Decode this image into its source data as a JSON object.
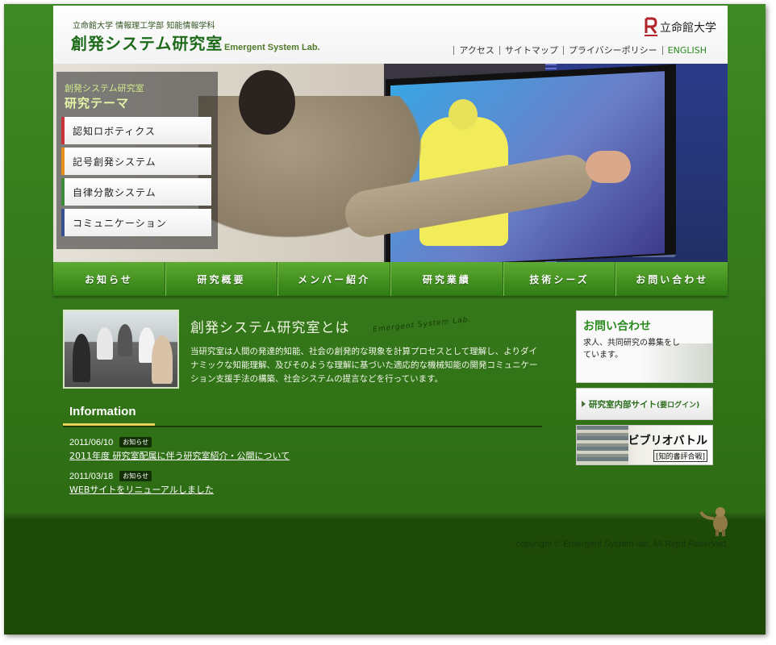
{
  "header": {
    "department": "立命館大学 情報理工学部 知能情報学科",
    "lab_name": "創発システム研究室",
    "lab_name_en": "Emergent System Lab.",
    "university": "立命館大学",
    "util_nav": [
      "アクセス",
      "サイトマップ",
      "プライバシーポリシー",
      "ENGLISH"
    ]
  },
  "research": {
    "subtitle": "創発システム研究室",
    "title": "研究テーマ",
    "items": [
      {
        "label": "認知ロボティクス",
        "color": "#c8333a"
      },
      {
        "label": "記号創発システム",
        "color": "#e8901c"
      },
      {
        "label": "自律分散システム",
        "color": "#3d8a3a"
      },
      {
        "label": "コミュニケーション",
        "color": "#35508a"
      }
    ]
  },
  "global_nav": [
    "お知らせ",
    "研究概要",
    "メンバー紹介",
    "研究業績",
    "技術シーズ",
    "お問い合わせ"
  ],
  "about": {
    "title": "創発システム研究室とは",
    "title_en": "Emergent System Lab.",
    "text": "当研究室は人間の発達的知能、社会の創発的な現象を計算プロセスとして理解し、よりダイナミックな知能理解、及びそのような理解に基づいた適応的な機械知能の開発コミュニケーション支援手法の構築、社会システムの提言などを行っています。"
  },
  "information": {
    "heading": "Information",
    "items": [
      {
        "date": "2011/06/10",
        "badge": "お知らせ",
        "title": "2011年度 研究室配属に伴う研究室紹介・公開について"
      },
      {
        "date": "2011/03/18",
        "badge": "お知らせ",
        "title": "WEBサイトをリニューアルしました"
      }
    ]
  },
  "sidebar": {
    "contact_title": "お問い合わせ",
    "contact_text": "求人、共同研究の募集をしています。",
    "internal_label": "研究室内部サイト",
    "internal_note": "(要ログイン)",
    "biblio_title": "ビブリオバトル",
    "biblio_sub": "[知的書評合戦]"
  },
  "footer": {
    "copyright": "copyright © Emergent System lab. All Right Reserved."
  },
  "colors": {
    "accent_green": "#2a8a1d",
    "background_green": "#3f8a24",
    "footer_green": "#1e4a08"
  }
}
